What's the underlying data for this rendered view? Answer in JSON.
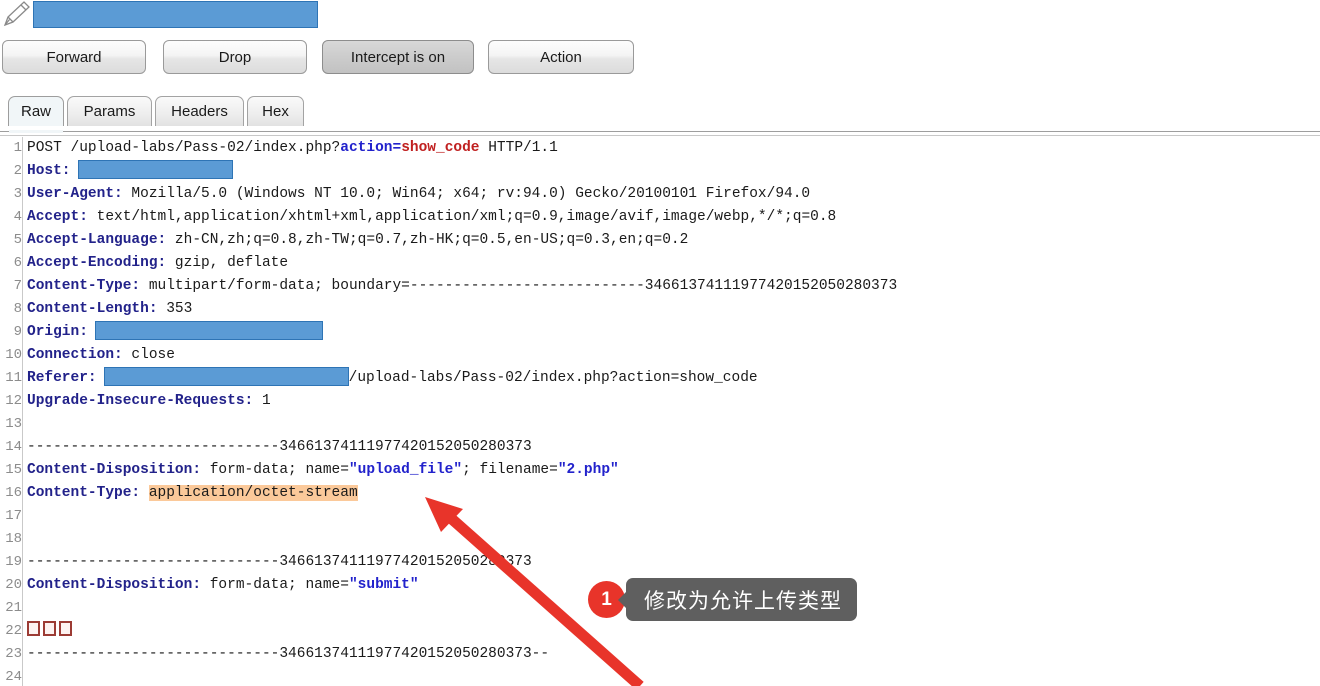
{
  "window": {
    "title_redacted": true,
    "pencil_icon": "pencil-icon"
  },
  "toolbar": {
    "buttons": [
      {
        "label": "Forward",
        "pressed": false
      },
      {
        "label": "Drop",
        "pressed": false
      },
      {
        "label": "Intercept is on",
        "pressed": true
      },
      {
        "label": "Action",
        "pressed": false
      }
    ]
  },
  "tabs": {
    "items": [
      {
        "label": "Raw",
        "active": true
      },
      {
        "label": "Params",
        "active": false
      },
      {
        "label": "Headers",
        "active": false
      },
      {
        "label": "Hex",
        "active": false
      }
    ]
  },
  "request": {
    "line_numbers": [
      "1",
      "2",
      "3",
      "4",
      "5",
      "6",
      "7",
      "8",
      "9",
      "10",
      "11",
      "12",
      "13",
      "14",
      "15",
      "16",
      "17",
      "18",
      "19",
      "20",
      "21",
      "22",
      "23",
      "24"
    ],
    "boundary": "34661374111977420152050280373",
    "lines": {
      "l1_method": "POST /upload-labs/Pass-02/index.php?",
      "l1_param": "action=",
      "l1_value": "show_code",
      "l1_proto": " HTTP/1.1",
      "l2_name": "Host:",
      "l3_name": "User-Agent:",
      "l3_value": " Mozilla/5.0 (Windows NT 10.0; Win64; x64; rv:94.0) Gecko/20100101 Firefox/94.0",
      "l4_name": "Accept:",
      "l4_value": " text/html,application/xhtml+xml,application/xml;q=0.9,image/avif,image/webp,*/*;q=0.8",
      "l5_name": "Accept-Language:",
      "l5_value": " zh-CN,zh;q=0.8,zh-TW;q=0.7,zh-HK;q=0.5,en-US;q=0.3,en;q=0.2",
      "l6_name": "Accept-Encoding:",
      "l6_value": " gzip, deflate",
      "l7_name": "Content-Type:",
      "l7_value": " multipart/form-data; boundary=---------------------------34661374111977420152050280373",
      "l8_name": "Content-Length:",
      "l8_value": " 353",
      "l9_name": "Origin:",
      "l10_name": "Connection:",
      "l10_value": " close",
      "l11_name": "Referer:",
      "l11_value": "/upload-labs/Pass-02/index.php?action=show_code",
      "l12_name": "Upgrade-Insecure-Requests:",
      "l12_value": " 1",
      "l14_boundary": "-----------------------------34661374111977420152050280373",
      "l15_name": "Content-Disposition:",
      "l15_a": " form-data; name=",
      "l15_q1": "\"upload_file\"",
      "l15_b": "; filename=",
      "l15_q2": "\"2.php\"",
      "l16_name": "Content-Type:",
      "l16_highlight": "application/octet-stream",
      "l19_boundary": "-----------------------------34661374111977420152050280373",
      "l20_name": "Content-Disposition:",
      "l20_a": " form-data; name=",
      "l20_q1": "\"submit\"",
      "l22_boxes": "□□□",
      "l23_boundary": "-----------------------------34661374111977420152050280373--"
    }
  },
  "annotation": {
    "badge_number": "1",
    "callout_text": "修改为允许上传类型",
    "arrow": "red-arrow pointing to Content-Type value on line 16",
    "badge_color": "#e8342a",
    "callout_bg": "#5f5f5f",
    "highlight_color": "#fbc99a",
    "redaction_color": "#5b9bd5"
  }
}
